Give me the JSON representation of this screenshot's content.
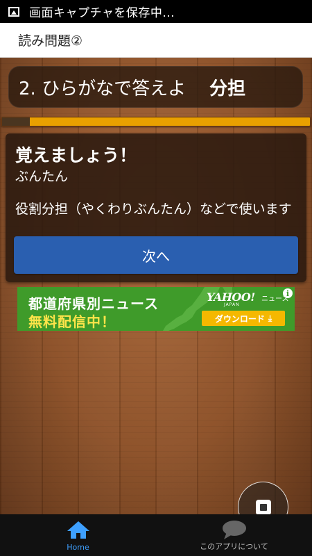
{
  "status_bar": {
    "text": "画面キャプチャを保存中...",
    "icon": "screenshot-icon"
  },
  "title_bar": {
    "title": "読み問題②"
  },
  "question": {
    "prompt": "2. ひらがなで答えよ",
    "word": "分担"
  },
  "progress": {
    "fraction": 0.09,
    "fill_color": "#4a3520",
    "track_color": "#e9a000"
  },
  "answer": {
    "heading": "覚えましょう！",
    "reading": "ぶんたん",
    "explanation": "役割分担（やくわりぶんたん）などで使います",
    "next_label": "次へ",
    "button_color": "#2a5fb0"
  },
  "ad": {
    "line1": "都道府県別ニュース",
    "line2": "無料配信中！",
    "brand": "YAHOO!",
    "brand_sub": "JAPAN",
    "brand_news": "ニュース",
    "download_label": "ダウンロード",
    "download_icon": "download-icon",
    "info_icon": "info-icon",
    "background_color": "#3f9b2a"
  },
  "fab": {
    "icon": "stop-icon"
  },
  "bottom_nav": {
    "items": [
      {
        "label": "Home",
        "icon": "home-icon",
        "active": true
      },
      {
        "label": "このアプリについて",
        "icon": "chat-bubble-icon",
        "active": false
      }
    ],
    "active_color": "#3ea0ff"
  }
}
